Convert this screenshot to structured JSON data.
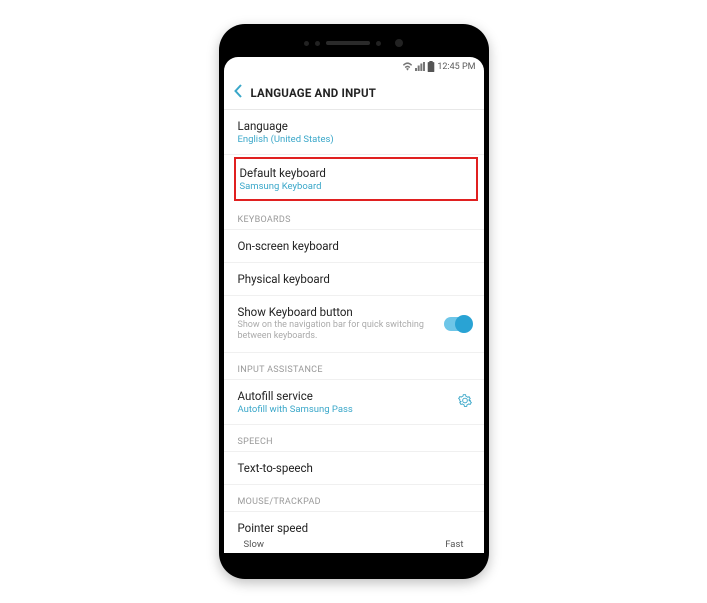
{
  "status": {
    "time": "12:45 PM"
  },
  "header": {
    "title": "LANGUAGE AND INPUT"
  },
  "rows": {
    "language": {
      "title": "Language",
      "sub": "English (United States)"
    },
    "defaultKeyboard": {
      "title": "Default keyboard",
      "sub": "Samsung Keyboard"
    },
    "sectionKeyboards": "KEYBOARDS",
    "onscreen": {
      "title": "On-screen keyboard"
    },
    "physical": {
      "title": "Physical keyboard"
    },
    "showKbBtn": {
      "title": "Show Keyboard button",
      "desc": "Show on the navigation bar for quick switching between keyboards."
    },
    "sectionInputAssist": "INPUT ASSISTANCE",
    "autofill": {
      "title": "Autofill service",
      "sub": "Autofill with Samsung Pass"
    },
    "sectionSpeech": "SPEECH",
    "tts": {
      "title": "Text-to-speech"
    },
    "sectionMouse": "MOUSE/TRACKPAD",
    "pointer": {
      "title": "Pointer speed",
      "slow": "Slow",
      "fast": "Fast"
    }
  }
}
